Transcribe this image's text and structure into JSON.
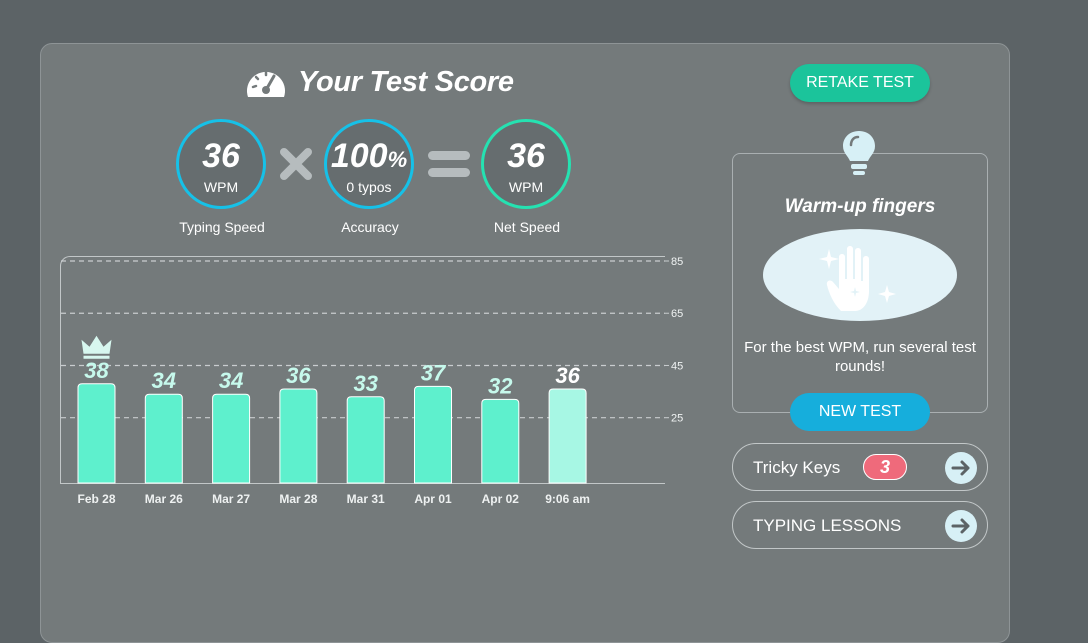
{
  "header": {
    "title": "Your Test Score",
    "icon": "speedometer-icon"
  },
  "stats": {
    "typing_speed": {
      "value": "36",
      "unit": "WPM",
      "label": "Typing Speed"
    },
    "accuracy": {
      "value": "100",
      "suffix": "%",
      "unit": "0 typos",
      "label": "Accuracy"
    },
    "net_speed": {
      "value": "36",
      "unit": "WPM",
      "label": "Net Speed"
    }
  },
  "colors": {
    "speed_ring": "#16c1e8",
    "net_ring": "#25e2b1",
    "bar": "#5ef0cd",
    "bar_latest": "#a7f7e4",
    "retake": "#1bc49b",
    "new_test": "#16aedc",
    "badge": "#ef6a7b"
  },
  "chart_data": {
    "type": "bar",
    "categories": [
      "Feb 28",
      "Mar 26",
      "Mar 27",
      "Mar 28",
      "Mar 31",
      "Apr 01",
      "Apr 02",
      "9:06 am"
    ],
    "values": [
      38,
      34,
      34,
      36,
      33,
      37,
      32,
      36
    ],
    "data_labels": [
      "38",
      "34",
      "34",
      "36",
      "33",
      "37",
      "32",
      "36"
    ],
    "yticks": [
      25,
      45,
      65,
      85
    ],
    "ytick_labels": [
      "25",
      "45",
      "65",
      "85"
    ],
    "ylim": [
      0,
      85
    ],
    "grid": "dashed horizontal",
    "best_index": 0,
    "best_icon": "crown-icon",
    "latest_index": 7
  },
  "actions": {
    "retake": "RETAKE TEST",
    "new_test": "NEW TEST"
  },
  "warmup": {
    "icon": "lightbulb-icon",
    "title": "Warm-up fingers",
    "image_icon": "sparkling-hand-icon",
    "text": "For the best WPM, run several test rounds!"
  },
  "links": {
    "tricky_keys": {
      "label": "Tricky Keys",
      "count": "3",
      "icon": "arrow-right-icon"
    },
    "typing_lessons": {
      "label": "TYPING LESSONS",
      "icon": "arrow-right-icon"
    }
  }
}
